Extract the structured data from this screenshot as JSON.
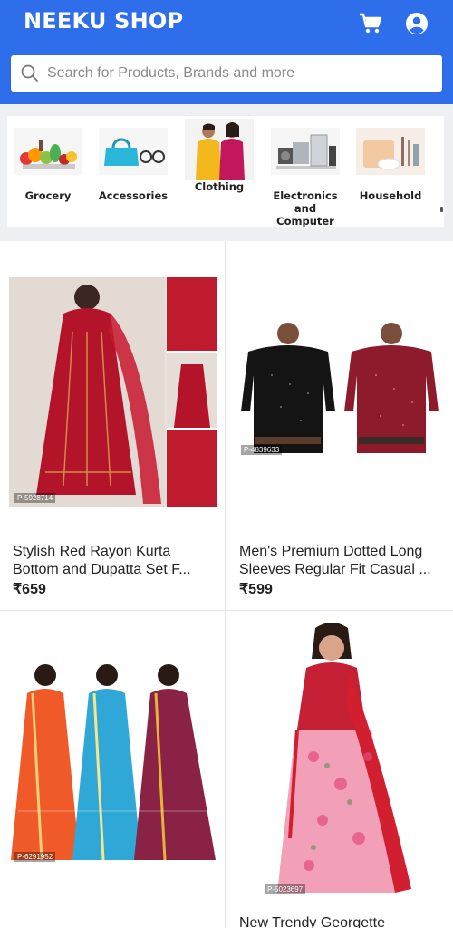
{
  "header": {
    "title": "NEEKU SHOP",
    "cart_icon": "cart-icon",
    "account_icon": "account-icon",
    "color": "#2f6eea"
  },
  "search": {
    "placeholder": "Search for Products, Brands and more",
    "value": ""
  },
  "categories": [
    {
      "label": "Grocery",
      "icon": "grocery-image"
    },
    {
      "label": "Accessories",
      "icon": "accessories-image"
    },
    {
      "label": "Clothing",
      "icon": "clothing-image"
    },
    {
      "label": "Electronics and Computer Accessories",
      "icon": "electronics-image"
    },
    {
      "label": "Household",
      "icon": "household-image"
    }
  ],
  "products": [
    {
      "title": "Stylish Red Rayon Kurta Bottom and Dupatta Set F...",
      "price": "₹659",
      "tag": "P-5928714"
    },
    {
      "title": "Men's Premium Dotted Long Sleeves Regular Fit Casual ...",
      "price": "₹599",
      "tag": "P-4839633"
    },
    {
      "title": "",
      "price": "",
      "tag": "P-6291952"
    },
    {
      "title": "New Trendy Georgette",
      "price": "",
      "tag": "P-5023697"
    }
  ]
}
